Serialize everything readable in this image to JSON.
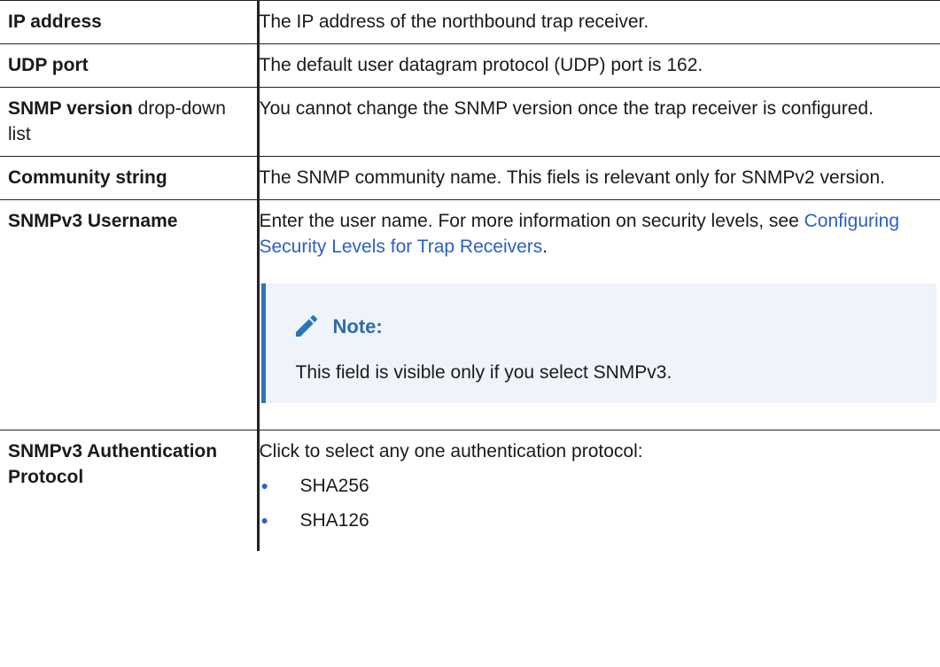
{
  "rows": [
    {
      "term_bold": "IP address",
      "description": "The IP address of the northbound trap receiver."
    },
    {
      "term_bold": "UDP port",
      "description": "The default user datagram protocol (UDP) port is 162."
    },
    {
      "term_bold": "SNMP version",
      "term_suffix": " drop-down list",
      "description": "You cannot change the SNMP version once the trap receiver is configured."
    },
    {
      "term_bold": "Community string",
      "description": "The SNMP community name. This fiels is relevant only for SNMPv2 version."
    },
    {
      "term_bold": "SNMPv3 Username",
      "description_pre": "Enter the user name. For more information on security levels, see ",
      "link_text": "Configuring Security Levels for Trap Receivers",
      "description_post": ".",
      "note": {
        "icon": "pencil-icon",
        "title": "Note:",
        "text": "This field is visible only if you select SNMPv3."
      }
    },
    {
      "term_bold": "SNMPv3 Authentication Protocol",
      "description": "Click to select any one authentication protocol:",
      "bullets": [
        "SHA256",
        "SHA126"
      ]
    }
  ],
  "colors": {
    "link": "#2b5fc8",
    "note_accent": "#2e75b6",
    "note_background": "#eef4fa",
    "note_title": "#2e6aa8"
  }
}
